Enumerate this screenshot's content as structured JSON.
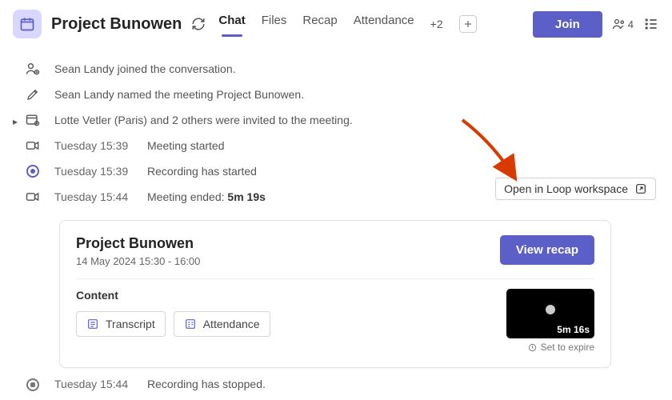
{
  "header": {
    "title": "Project Bunowen",
    "tabs": [
      "Chat",
      "Files",
      "Recap",
      "Attendance"
    ],
    "more_tabs": "+2",
    "join_label": "Join",
    "people_count": "4"
  },
  "events": {
    "joined": "Sean Landy joined the conversation.",
    "named": "Sean Landy named the meeting Project Bunowen.",
    "invited": "Lotte Vetler (Paris) and 2 others were invited to the meeting.",
    "started_ts": "Tuesday 15:39",
    "started": "Meeting started",
    "rec_ts": "Tuesday 15:39",
    "rec": "Recording has started",
    "ended_ts": "Tuesday 15:44",
    "ended_prefix": "Meeting ended: ",
    "ended_dur": "5m 19s",
    "stopped_ts": "Tuesday 15:44",
    "stopped": "Recording has stopped."
  },
  "loop_button": "Open in Loop workspace",
  "card": {
    "title": "Project Bunowen",
    "time": "14 May 2024 15:30 - 16:00",
    "recap_label": "View recap",
    "content_label": "Content",
    "transcript": "Transcript",
    "attendance": "Attendance",
    "video_duration": "5m 16s",
    "expire": "Set to expire"
  }
}
